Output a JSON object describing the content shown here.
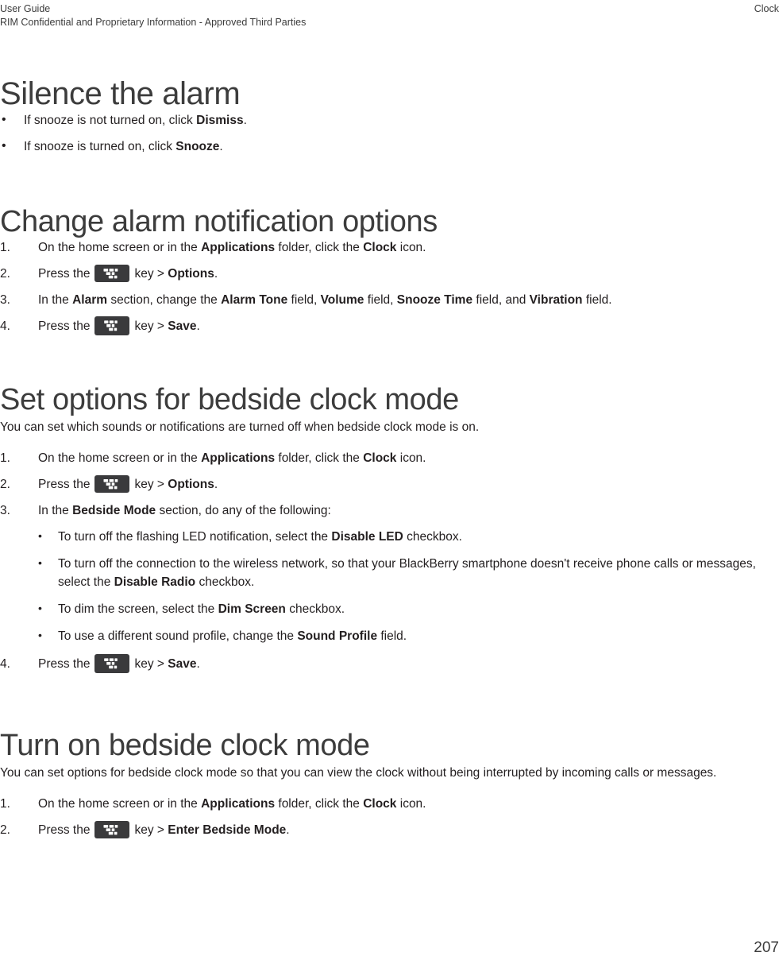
{
  "header": {
    "left_title": "User Guide",
    "right_title": "Clock",
    "confidentiality": "RIM Confidential and Proprietary Information - Approved Third Parties"
  },
  "footer": {
    "page_number": "207"
  },
  "icons": {
    "menu_key": "blackberry-menu-key-icon"
  },
  "sections": {
    "silence_alarm": {
      "title": "Silence the alarm",
      "bullets": [
        {
          "pre": "If snooze is not turned on, click ",
          "bold": "Dismiss",
          "post": "."
        },
        {
          "pre": "If snooze is turned on, click ",
          "bold": "Snooze",
          "post": "."
        }
      ]
    },
    "change_alarm_notification": {
      "title": "Change alarm notification options",
      "steps": [
        {
          "type": "text",
          "p1": "On the home screen or in the ",
          "b1": "Applications",
          "p2": " folder, click the ",
          "b2": "Clock",
          "p3": " icon."
        },
        {
          "type": "key",
          "pre": "Press the",
          "mid": "key > ",
          "bold": "Options",
          "post": "."
        },
        {
          "type": "rich",
          "p1": "In the ",
          "b1": "Alarm",
          "p2": " section, change the ",
          "b2": "Alarm Tone",
          "p3": " field, ",
          "b3": "Volume",
          "p4": " field, ",
          "b4": "Snooze Time",
          "p5": " field, and ",
          "b5": "Vibration",
          "p6": " field."
        },
        {
          "type": "key",
          "pre": "Press the",
          "mid": "key > ",
          "bold": "Save",
          "post": "."
        }
      ]
    },
    "set_bedside_options": {
      "title": "Set options for bedside clock mode",
      "intro": "You can set which sounds or notifications are turned off when bedside clock mode is on.",
      "steps": [
        {
          "type": "text",
          "p1": "On the home screen or in the ",
          "b1": "Applications",
          "p2": " folder, click the ",
          "b2": "Clock",
          "p3": " icon."
        },
        {
          "type": "key",
          "pre": "Press the",
          "mid": "key > ",
          "bold": "Options",
          "post": "."
        },
        {
          "type": "subbullets",
          "p1": "In the ",
          "b1": "Bedside Mode",
          "p2": " section, do any of the following:",
          "bullets": [
            {
              "pre": "To turn off the flashing LED notification, select the ",
              "bold": "Disable LED",
              "post": " checkbox."
            },
            {
              "pre": "To turn off the connection to the wireless network, so that your BlackBerry smartphone doesn't receive phone calls or messages, select the ",
              "bold": "Disable Radio",
              "post": " checkbox."
            },
            {
              "pre": "To dim the screen, select the ",
              "bold": "Dim Screen",
              "post": " checkbox."
            },
            {
              "pre": "To use a different sound profile, change the ",
              "bold": "Sound Profile",
              "post": " field."
            }
          ]
        },
        {
          "type": "key",
          "pre": "Press the",
          "mid": "key > ",
          "bold": "Save",
          "post": "."
        }
      ]
    },
    "turn_on_bedside": {
      "title": "Turn on bedside clock mode",
      "intro": "You can set options for bedside clock mode so that you can view the clock without being interrupted by incoming calls or messages.",
      "steps": [
        {
          "type": "text",
          "p1": "On the home screen or in the ",
          "b1": "Applications",
          "p2": " folder, click the ",
          "b2": "Clock",
          "p3": " icon."
        },
        {
          "type": "key",
          "pre": "Press the",
          "mid": "key > ",
          "bold": "Enter Bedside Mode",
          "post": "."
        }
      ]
    }
  }
}
